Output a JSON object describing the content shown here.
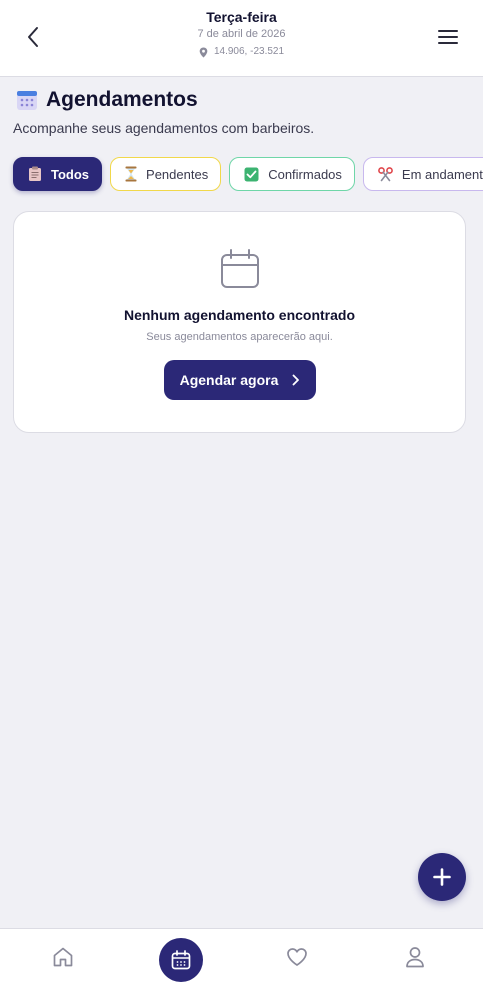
{
  "header": {
    "day": "Terça-feira",
    "date": "7 de abril de 2026",
    "location": "14.906, -23.521"
  },
  "page": {
    "title": "Agendamentos",
    "subtitle": "Acompanhe seus agendamentos com barbeiros."
  },
  "filters": [
    {
      "label": "Todos",
      "icon": "clipboard-icon",
      "active": true
    },
    {
      "label": "Pendentes",
      "icon": "hourglass-icon",
      "active": false
    },
    {
      "label": "Confirmados",
      "icon": "check-box-icon",
      "active": false
    },
    {
      "label": "Em andamento",
      "icon": "scissors-icon",
      "active": false
    }
  ],
  "empty_state": {
    "title": "Nenhum agendamento encontrado",
    "subtitle": "Seus agendamentos aparecerão aqui.",
    "button_label": "Agendar agora"
  },
  "bottom_nav": [
    "home-icon",
    "calendar-icon",
    "heart-icon",
    "user-icon"
  ],
  "colors": {
    "primary": "#2b2877",
    "background": "#f0f0f5",
    "pending_border": "#f1d84a",
    "confirmed_border": "#6fd6a8",
    "in_progress_border": "#c8b8ee"
  }
}
